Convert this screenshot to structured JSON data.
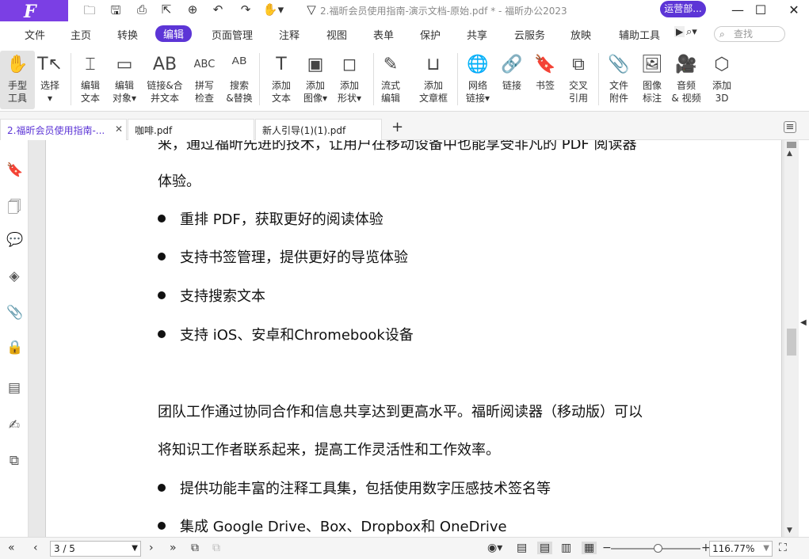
{
  "app": {
    "logo_letter": "F",
    "window_title": "2.福昕会员使用指南-演示文档-原始.pdf * - 福昕办公2023",
    "user_button": "运营部...",
    "window_controls": {
      "minimize": "—",
      "maximize": "☐",
      "close": "✕"
    }
  },
  "quick_access": [
    {
      "icon": "folder-icon",
      "glyph": "🗀"
    },
    {
      "icon": "save-icon",
      "glyph": "🖫"
    },
    {
      "icon": "print-icon",
      "glyph": "⎙"
    },
    {
      "icon": "export-icon",
      "glyph": "⇱"
    },
    {
      "icon": "new-icon",
      "glyph": "⊕"
    },
    {
      "icon": "undo-icon",
      "glyph": "↶"
    },
    {
      "icon": "redo-icon",
      "glyph": "↷"
    },
    {
      "icon": "hand-dropdown-icon",
      "glyph": "✋▾"
    },
    {
      "icon": "customize-icon",
      "glyph": "▽"
    }
  ],
  "menu": {
    "items": [
      "文件",
      "主页",
      "转换",
      "编辑",
      "页面管理",
      "注释",
      "视图",
      "表单",
      "保护",
      "共享",
      "云服务",
      "放映",
      "辅助工具"
    ],
    "active_index": 3,
    "search_placeholder": "查找"
  },
  "ribbon": {
    "tools": [
      {
        "label": "手型\n工具",
        "icon": "hand-icon",
        "glyph": "✋",
        "active": true
      },
      {
        "label": "选择\n▾",
        "icon": "select-icon",
        "glyph": "T↖"
      },
      {
        "label": "编辑\n文本",
        "icon": "edit-text-icon",
        "glyph": "⌶"
      },
      {
        "label": "编辑\n对象▾",
        "icon": "edit-object-icon",
        "glyph": "▭"
      },
      {
        "label": "链接&合\n并文本",
        "icon": "link-merge-text-icon",
        "glyph": "AB"
      },
      {
        "label": "拼写\n检查",
        "icon": "spell-check-icon",
        "glyph": "ABC"
      },
      {
        "label": "搜索\n&替换",
        "icon": "search-replace-icon",
        "glyph": "ᴬᴮ"
      },
      {
        "label": "添加\n文本",
        "icon": "add-text-icon",
        "glyph": "T"
      },
      {
        "label": "添加\n图像▾",
        "icon": "add-image-icon",
        "glyph": "▣"
      },
      {
        "label": "添加\n形状▾",
        "icon": "add-shape-icon",
        "glyph": "◻"
      },
      {
        "label": "流式\n编辑",
        "icon": "flow-edit-icon",
        "glyph": "✎"
      },
      {
        "label": "添加\n文章框",
        "icon": "article-box-icon",
        "glyph": "⊔"
      },
      {
        "label": "网络\n链接▾",
        "icon": "web-link-icon",
        "glyph": "🌐"
      },
      {
        "label": "链接",
        "icon": "link-icon",
        "glyph": "🔗"
      },
      {
        "label": "书签",
        "icon": "bookmark-icon",
        "glyph": "🔖"
      },
      {
        "label": "交叉\n引用",
        "icon": "cross-reference-icon",
        "glyph": "⧉"
      },
      {
        "label": "文件\n附件",
        "icon": "file-attachment-icon",
        "glyph": "📎"
      },
      {
        "label": "图像\n标注",
        "icon": "image-annotation-icon",
        "glyph": "🖼"
      },
      {
        "label": "音频\n& 视频",
        "icon": "audio-video-icon",
        "glyph": "🎥"
      },
      {
        "label": "添加\n3D",
        "icon": "add-3d-icon",
        "glyph": "⬡"
      }
    ]
  },
  "tabs": [
    {
      "label": "2.福昕会员使用指南-...",
      "active": true
    },
    {
      "label": "咖啡.pdf"
    },
    {
      "label": "新人引导(1)(1).pdf"
    }
  ],
  "left_panel_icons": [
    "bookmark-icon",
    "pages-icon",
    "comment-icon",
    "layers-icon",
    "attachment-icon",
    "security-icon",
    "form-icon",
    "signature-icon",
    "compare-icon"
  ],
  "document": {
    "lines": [
      {
        "type": "p",
        "text": "来，通过福昕先进的技术，让用户在移动设备中也能享受非凡的 PDF 阅读器"
      },
      {
        "type": "p",
        "text": "体验。"
      },
      {
        "type": "bullet",
        "text": "重排 PDF，获取更好的阅读体验"
      },
      {
        "type": "bullet",
        "text": "支持书签管理，提供更好的导览体验"
      },
      {
        "type": "bullet",
        "text": "支持搜索文本"
      },
      {
        "type": "bullet",
        "text": "支持 iOS、安卓和Chromebook设备"
      },
      {
        "type": "p",
        "text": "团队工作通过协同合作和信息共享达到更高水平。福昕阅读器（移动版）可以"
      },
      {
        "type": "p",
        "text": "将知识工作者联系起来，提高工作灵活性和工作效率。"
      },
      {
        "type": "bullet",
        "text": "提供功能丰富的注释工具集，包括使用数字压感技术签名等"
      },
      {
        "type": "bullet",
        "text": "集成 Google Drive、Box、Dropbox和 OneDrive"
      }
    ]
  },
  "status": {
    "page_indicator": "3 / 5",
    "zoom": "116.77%",
    "zoom_fraction": 0.52
  }
}
